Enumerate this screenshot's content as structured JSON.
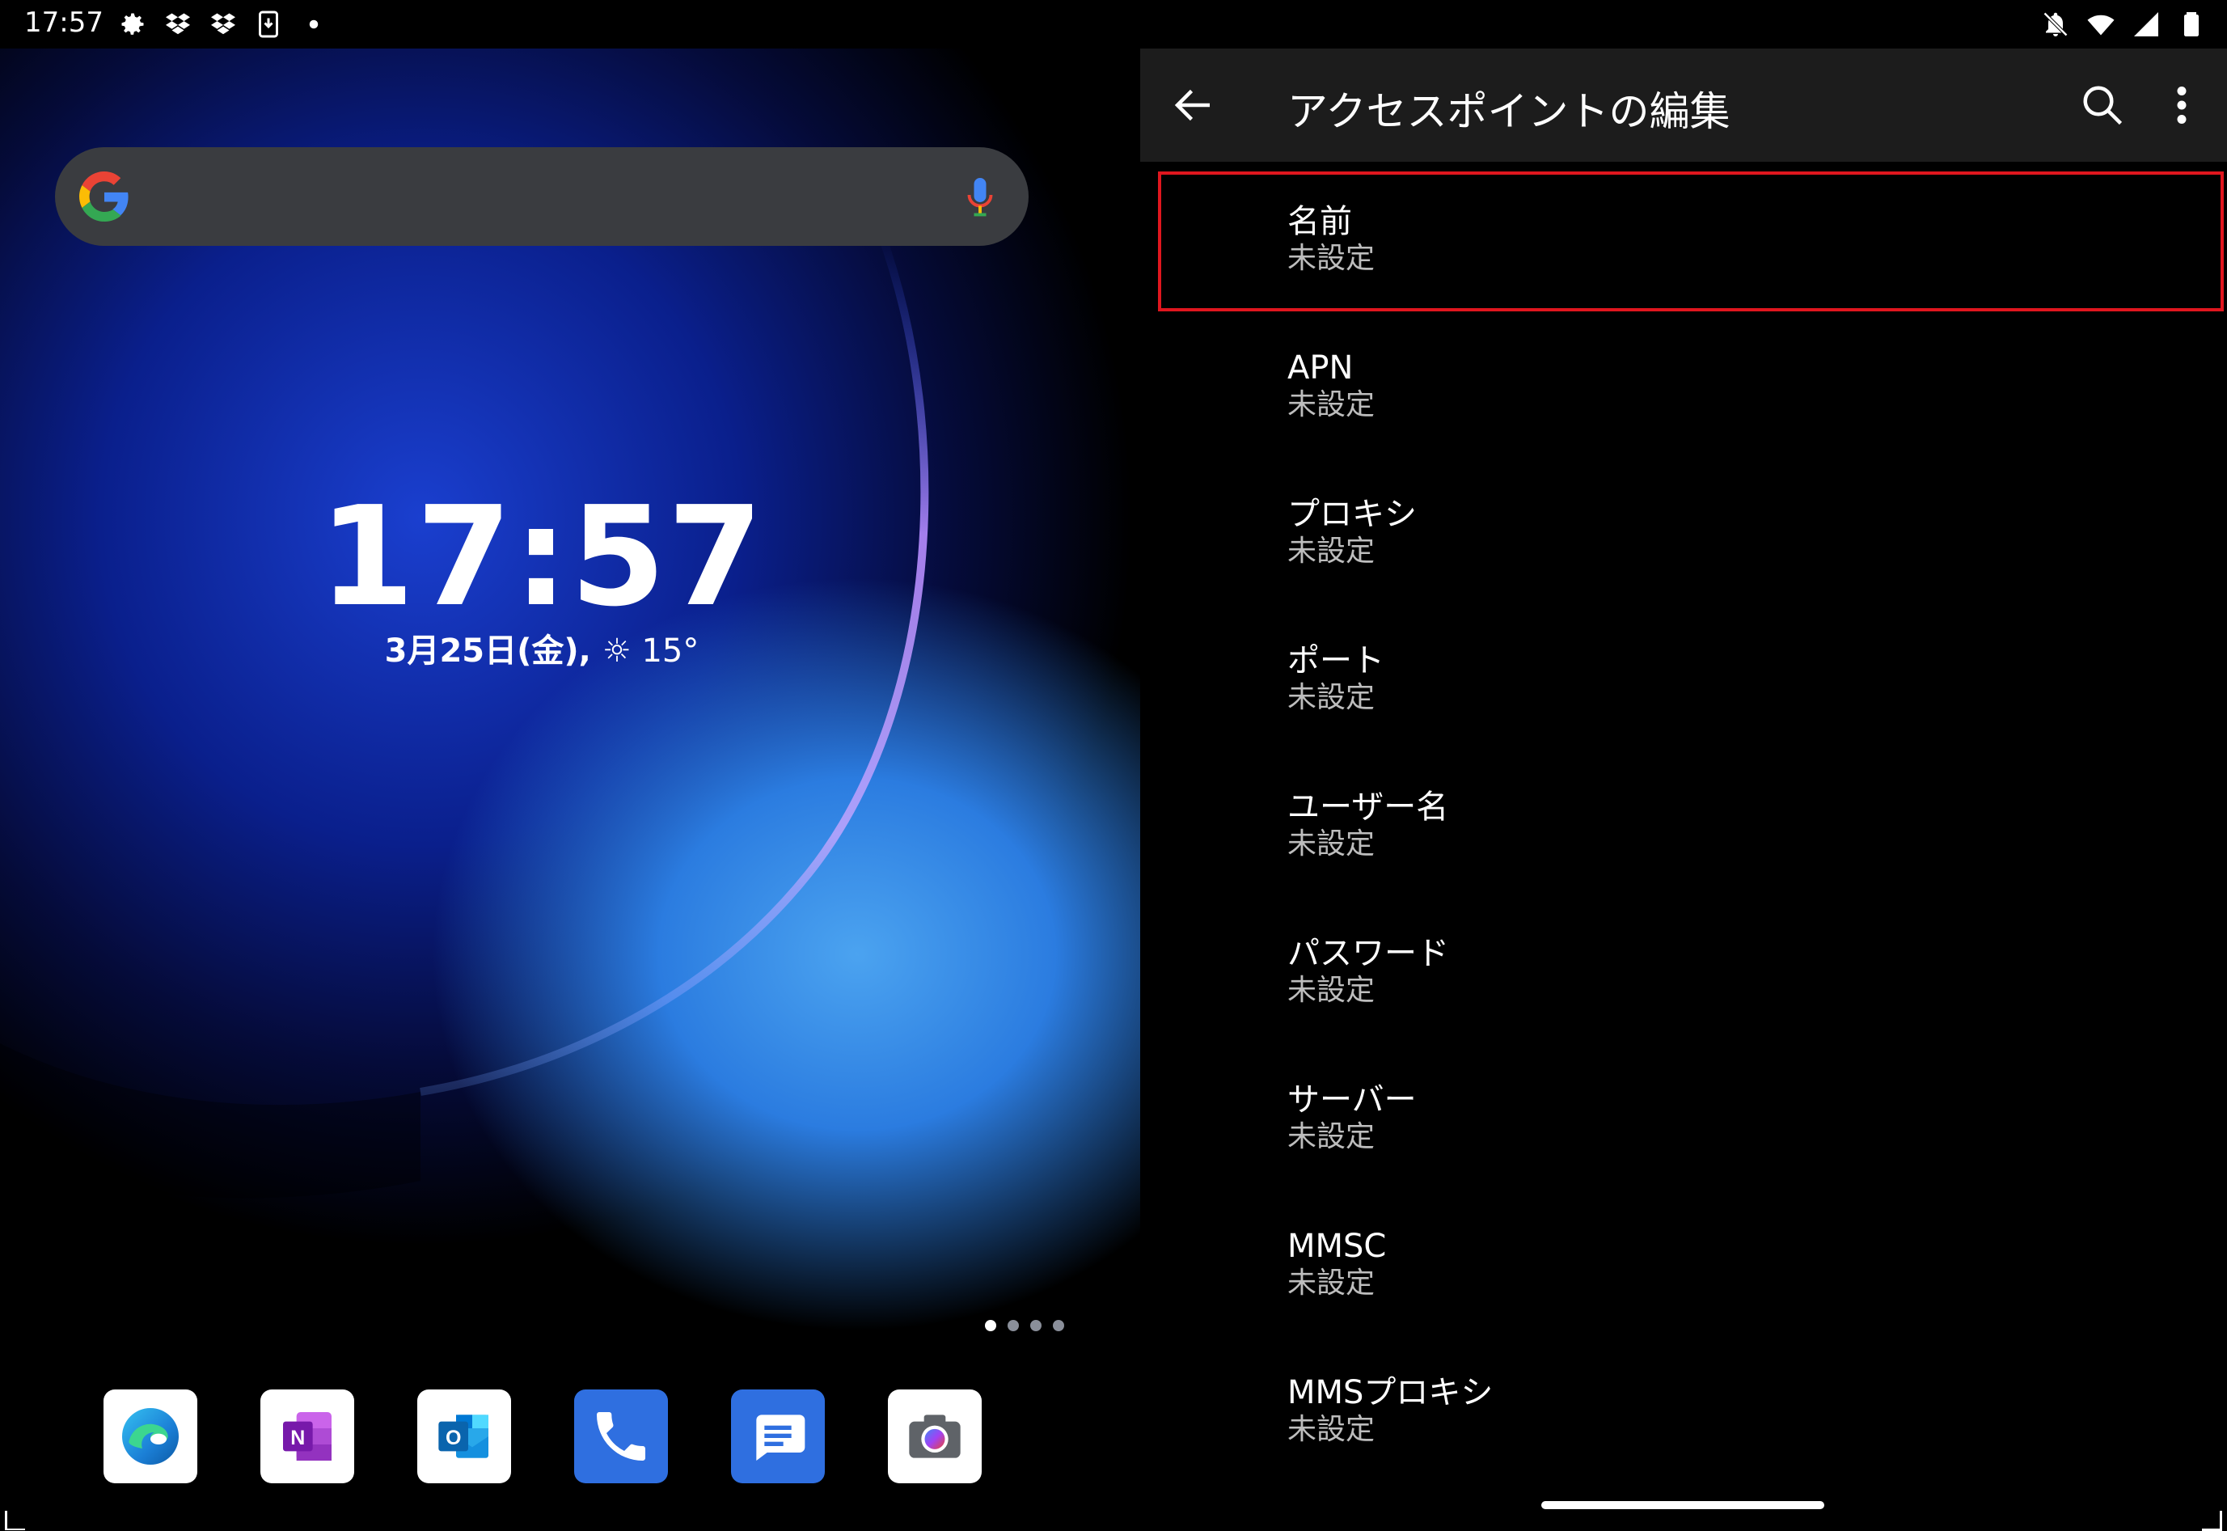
{
  "status_bar": {
    "time": "17:57",
    "left_icons": [
      "gear-icon",
      "dropbox-icon",
      "dropbox-icon",
      "download-icon",
      "dot-icon"
    ],
    "right_icons": [
      "bell-off-icon",
      "wifi-icon",
      "signal-icon",
      "battery-icon"
    ]
  },
  "home": {
    "search_icon": "google-g-icon",
    "mic_icon": "mic-icon",
    "clock": "17:57",
    "date": "3月25日(金),",
    "weather": "☼ 15°",
    "page_dots": 4,
    "active_page": 0,
    "dock_apps": [
      {
        "name": "edge",
        "icon": "edge-icon"
      },
      {
        "name": "onenote",
        "icon": "onenote-icon"
      },
      {
        "name": "outlook",
        "icon": "outlook-icon"
      },
      {
        "name": "phone",
        "icon": "phone-icon"
      },
      {
        "name": "messages",
        "icon": "messages-icon"
      },
      {
        "name": "camera",
        "icon": "camera-icon"
      }
    ]
  },
  "settings": {
    "title": "アクセスポイントの編集",
    "colors": {
      "highlight": "#e0161e",
      "appbar": "#1c1c1c"
    },
    "items": [
      {
        "label": "名前",
        "value": "未設定"
      },
      {
        "label": "APN",
        "value": "未設定"
      },
      {
        "label": "プロキシ",
        "value": "未設定"
      },
      {
        "label": "ポート",
        "value": "未設定"
      },
      {
        "label": "ユーザー名",
        "value": "未設定"
      },
      {
        "label": "パスワード",
        "value": "未設定"
      },
      {
        "label": "サーバー",
        "value": "未設定"
      },
      {
        "label": "MMSC",
        "value": "未設定"
      },
      {
        "label": "MMSプロキシ",
        "value": "未設定"
      }
    ]
  }
}
